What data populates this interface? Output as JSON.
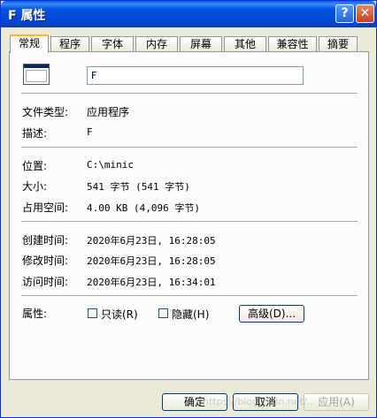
{
  "window": {
    "title": "F 属性",
    "help_glyph": "?",
    "close_glyph": "✕"
  },
  "tabs": [
    "常规",
    "程序",
    "字体",
    "内存",
    "屏幕",
    "其他",
    "兼容性",
    "摘要"
  ],
  "general": {
    "file_name": "F",
    "file_type_label": "文件类型:",
    "file_type_value": "应用程序",
    "description_label": "描述:",
    "description_value": "F",
    "location_label": "位置:",
    "location_value": "C:\\minic",
    "size_label": "大小:",
    "size_value": "541 字节 (541 字节)",
    "disk_size_label": "占用空间:",
    "disk_size_value": "4.00 KB (4,096 字节)",
    "created_label": "创建时间:",
    "created_value": "2020年6月23日, 16:28:05",
    "modified_label": "修改时间:",
    "modified_value": "2020年6月23日, 16:28:05",
    "accessed_label": "访问时间:",
    "accessed_value": "2020年6月23日, 16:34:01",
    "attributes_label": "属性:",
    "readonly_label": "只读(R)",
    "hidden_label": "隐藏(H)",
    "advanced_label": "高级(D)..."
  },
  "footer": {
    "ok_label": "确定",
    "cancel_label": "取消",
    "apply_label": "应用(A)"
  },
  "watermark": "https://blog.csdn.net/..."
}
